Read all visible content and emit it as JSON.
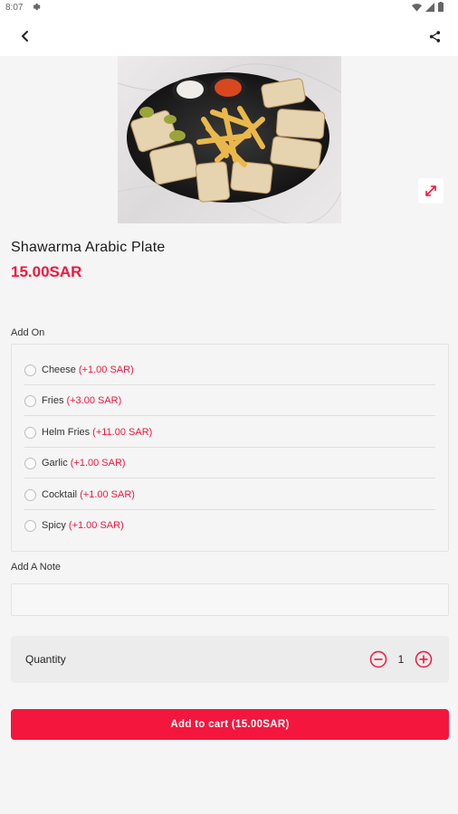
{
  "status_bar": {
    "time": "8:07"
  },
  "product": {
    "name": "Shawarma Arabic Plate",
    "price": "15.00SAR"
  },
  "addons": {
    "label": "Add On",
    "items": [
      {
        "name": "Cheese",
        "price": "(+1.00 SAR)"
      },
      {
        "name": "Fries",
        "price": "(+3.00 SAR)"
      },
      {
        "name": "Helm Fries",
        "price": "(+11.00 SAR)"
      },
      {
        "name": "Garlic",
        "price": "(+1.00 SAR)"
      },
      {
        "name": "Cocktail",
        "price": "(+1.00 SAR)"
      },
      {
        "name": "Spicy",
        "price": "(+1.00 SAR)"
      }
    ]
  },
  "note": {
    "label": "Add A Note",
    "value": "",
    "placeholder": ""
  },
  "quantity": {
    "label": "Quantity",
    "value": "1"
  },
  "cart_button": {
    "label": "Add to cart (15.00SAR)"
  },
  "colors": {
    "accent": "#f0173d",
    "background": "#f5f5f5"
  },
  "icons": {
    "back": "arrow-back-icon",
    "share": "share-icon",
    "expand": "expand-icon",
    "minus": "minus-circle-icon",
    "plus": "plus-circle-icon"
  }
}
